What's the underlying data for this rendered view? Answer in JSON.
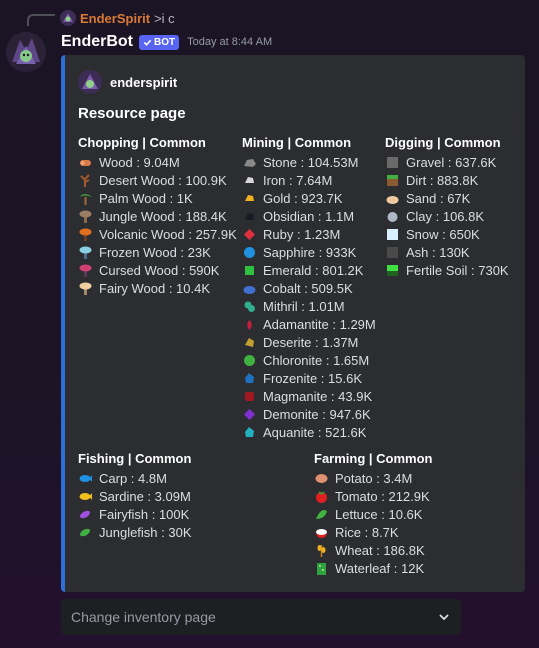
{
  "reply": {
    "username": "EnderSpirit",
    "text": ">i c"
  },
  "message": {
    "author": "EnderBot",
    "badge": "BOT",
    "timestamp": "Today at 8:44 AM"
  },
  "embed": {
    "accent": "#2c6fd8",
    "author": "enderspirit",
    "title": "Resource page",
    "fields": [
      {
        "name": "Chopping | Common",
        "items": [
          {
            "icon": "wood-icon",
            "label": "Wood : 9.04M"
          },
          {
            "icon": "desert-wood-icon",
            "label": "Desert Wood : 100.9K"
          },
          {
            "icon": "palm-wood-icon",
            "label": "Palm Wood : 1K"
          },
          {
            "icon": "jungle-wood-icon",
            "label": "Jungle Wood : 188.4K"
          },
          {
            "icon": "volcanic-wood-icon",
            "label": "Volcanic Wood : 257.9K"
          },
          {
            "icon": "frozen-wood-icon",
            "label": "Frozen Wood : 23K"
          },
          {
            "icon": "cursed-wood-icon",
            "label": "Cursed Wood : 590K"
          },
          {
            "icon": "fairy-wood-icon",
            "label": "Fairy Wood : 10.4K"
          }
        ]
      },
      {
        "name": "Mining | Common",
        "items": [
          {
            "icon": "stone-icon",
            "label": "Stone : 104.53M"
          },
          {
            "icon": "iron-icon",
            "label": "Iron : 7.64M"
          },
          {
            "icon": "gold-icon",
            "label": "Gold : 923.7K"
          },
          {
            "icon": "obsidian-icon",
            "label": "Obsidian : 1.1M"
          },
          {
            "icon": "ruby-icon",
            "label": "Ruby : 1.23M"
          },
          {
            "icon": "sapphire-icon",
            "label": "Sapphire : 933K"
          },
          {
            "icon": "emerald-icon",
            "label": "Emerald : 801.2K"
          },
          {
            "icon": "cobalt-icon",
            "label": "Cobalt : 509.5K"
          },
          {
            "icon": "mithril-icon",
            "label": "Mithril : 1.01M"
          },
          {
            "icon": "adamantite-icon",
            "label": "Adamantite : 1.29M"
          },
          {
            "icon": "deserite-icon",
            "label": "Deserite : 1.37M"
          },
          {
            "icon": "chloronite-icon",
            "label": "Chloronite : 1.65M"
          },
          {
            "icon": "frozenite-icon",
            "label": "Frozenite : 15.6K"
          },
          {
            "icon": "magmanite-icon",
            "label": "Magmanite : 43.9K"
          },
          {
            "icon": "demonite-icon",
            "label": "Demonite : 947.6K"
          },
          {
            "icon": "aquanite-icon",
            "label": "Aquanite : 521.6K"
          }
        ]
      },
      {
        "name": "Digging | Common",
        "items": [
          {
            "icon": "gravel-icon",
            "label": "Gravel : 637.6K"
          },
          {
            "icon": "dirt-icon",
            "label": "Dirt : 883.8K"
          },
          {
            "icon": "sand-icon",
            "label": "Sand : 67K"
          },
          {
            "icon": "clay-icon",
            "label": "Clay : 106.8K"
          },
          {
            "icon": "snow-icon",
            "label": "Snow : 650K"
          },
          {
            "icon": "ash-icon",
            "label": "Ash : 130K"
          },
          {
            "icon": "fertile-soil-icon",
            "label": "Fertile Soil : 730K"
          }
        ]
      },
      {
        "name": "Fishing | Common",
        "items": [
          {
            "icon": "carp-icon",
            "label": "Carp : 4.8M"
          },
          {
            "icon": "sardine-icon",
            "label": "Sardine : 3.09M"
          },
          {
            "icon": "fairyfish-icon",
            "label": "Fairyfish : 100K"
          },
          {
            "icon": "junglefish-icon",
            "label": "Junglefish : 30K"
          }
        ]
      },
      {
        "name": "Farming | Common",
        "items": [
          {
            "icon": "potato-icon",
            "label": "Potato : 3.4M"
          },
          {
            "icon": "tomato-icon",
            "label": "Tomato : 212.9K"
          },
          {
            "icon": "lettuce-icon",
            "label": "Lettuce : 10.6K"
          },
          {
            "icon": "rice-icon",
            "label": "Rice : 8.7K"
          },
          {
            "icon": "wheat-icon",
            "label": "Wheat : 186.8K"
          },
          {
            "icon": "waterleaf-icon",
            "label": "Waterleaf : 12K"
          }
        ]
      }
    ]
  },
  "dropdown": {
    "placeholder": "Change inventory page"
  }
}
